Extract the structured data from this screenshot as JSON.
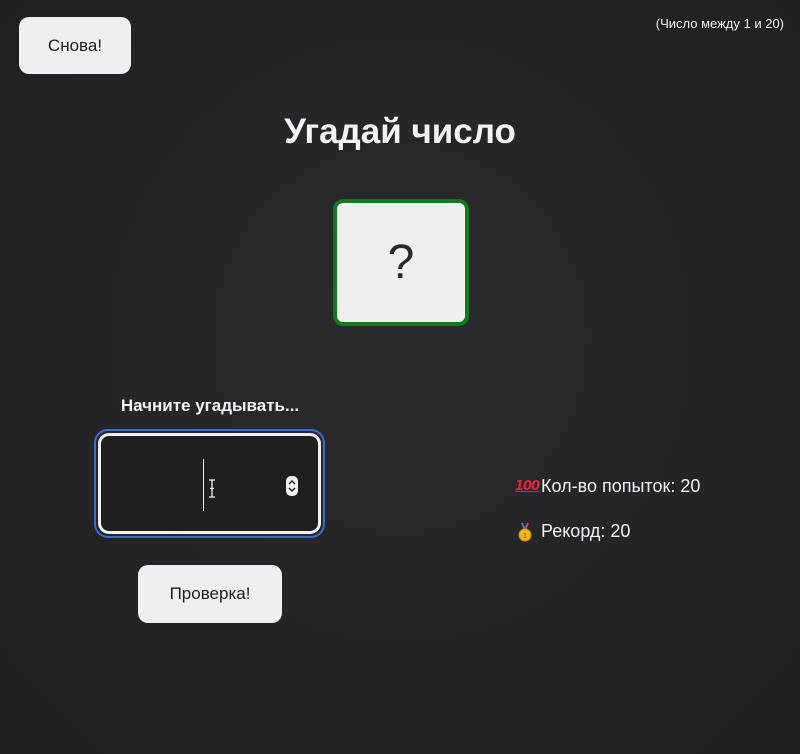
{
  "header": {
    "again_label": "Снова!",
    "range_hint": "(Число между 1 и 20)"
  },
  "main": {
    "title": "Угадай число",
    "secret_placeholder": "?",
    "guess_label": "Начните угадывать...",
    "guess_value": "",
    "check_label": "Проверка!"
  },
  "stats": {
    "attempts_label": "Кол-во попыток: 20",
    "record_label": "Рекорд: 20",
    "attempts_icon": "hundred-points-icon",
    "record_icon": "gold-medal-icon"
  },
  "colors": {
    "box_border": "#0e7a1c",
    "input_focus": "#3c6bc9",
    "background": "#252527"
  }
}
